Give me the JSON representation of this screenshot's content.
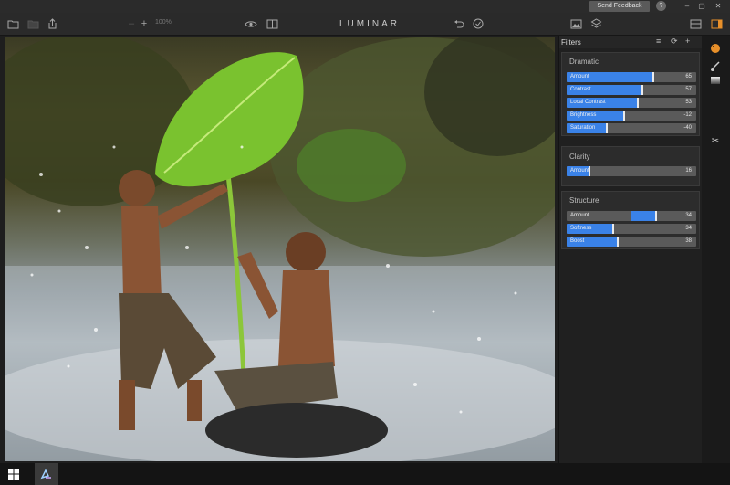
{
  "titlebar": {
    "feedback_label": "Send Feedback",
    "help_label": "?",
    "minimize": "–",
    "restore": "▢",
    "close": "✕"
  },
  "toolbar": {
    "zoom_label": "100%",
    "logo": "LUMINAR"
  },
  "filters_panel": {
    "title": "Filters",
    "groups": [
      {
        "title": "Dramatic",
        "sliders": [
          {
            "label": "Amount",
            "value": "65",
            "fraction": 0.66
          },
          {
            "label": "Contrast",
            "value": "57",
            "fraction": 0.58
          },
          {
            "label": "Local Contrast",
            "value": "53",
            "fraction": 0.54
          },
          {
            "label": "Brightness",
            "value": "-12",
            "fraction": 0.44
          },
          {
            "label": "Saturation",
            "value": "-40",
            "fraction": 0.3
          }
        ]
      },
      {
        "title": "Clarity",
        "sliders": [
          {
            "label": "Amount",
            "value": "16",
            "fraction": 0.17
          }
        ]
      },
      {
        "title": "Structure",
        "sliders": [
          {
            "label": "Amount",
            "value": "34",
            "fraction": 0.68
          },
          {
            "label": "Softness",
            "value": "34",
            "fraction": 0.35
          },
          {
            "label": "Boost",
            "value": "38",
            "fraction": 0.39
          }
        ]
      }
    ]
  },
  "colors": {
    "accent": "#3a82e8",
    "slider_track": "#5a5a5a",
    "panel_bg": "#202020"
  }
}
